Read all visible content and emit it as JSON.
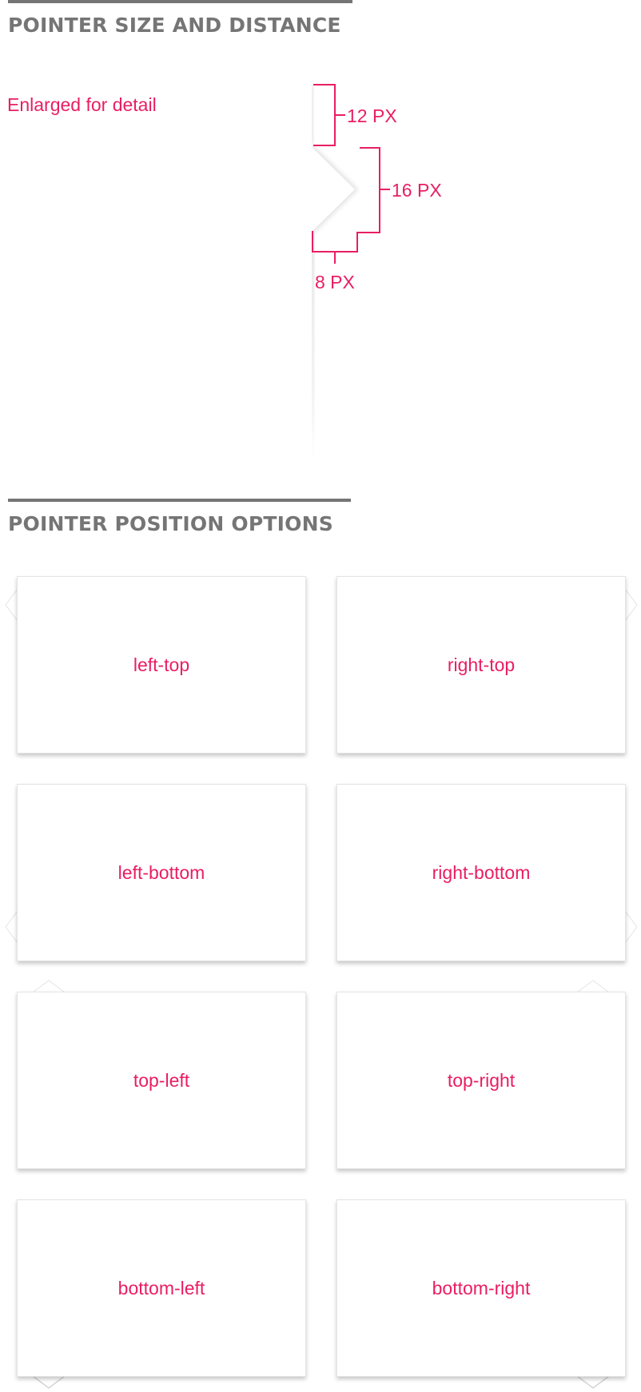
{
  "sections": {
    "size": {
      "title": "POINTER SIZE AND DISTANCE"
    },
    "positions": {
      "title": "POINTER POSITION OPTIONS"
    }
  },
  "detail": {
    "caption": "Enlarged for detail",
    "measure_distance": "12 PX",
    "measure_height": "16 PX",
    "measure_depth": "8 PX"
  },
  "cards": [
    {
      "label": "left-top"
    },
    {
      "label": "right-top"
    },
    {
      "label": "left-bottom"
    },
    {
      "label": "right-bottom"
    },
    {
      "label": "top-left"
    },
    {
      "label": "top-right"
    },
    {
      "label": "bottom-left"
    },
    {
      "label": "bottom-right"
    }
  ],
  "colors": {
    "accent": "#e91e63",
    "heading": "#757575",
    "card_border": "#e4e4e4"
  }
}
